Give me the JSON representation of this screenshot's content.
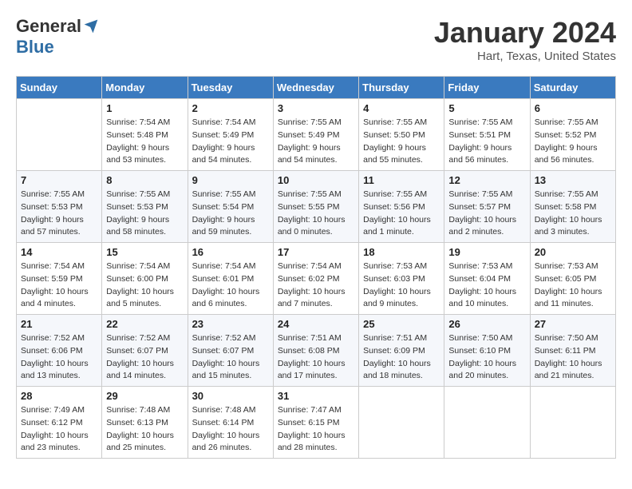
{
  "logo": {
    "general": "General",
    "blue": "Blue"
  },
  "title": {
    "month": "January 2024",
    "location": "Hart, Texas, United States"
  },
  "header_days": [
    "Sunday",
    "Monday",
    "Tuesday",
    "Wednesday",
    "Thursday",
    "Friday",
    "Saturday"
  ],
  "weeks": [
    [
      {
        "day": "",
        "info": ""
      },
      {
        "day": "1",
        "info": "Sunrise: 7:54 AM\nSunset: 5:48 PM\nDaylight: 9 hours\nand 53 minutes."
      },
      {
        "day": "2",
        "info": "Sunrise: 7:54 AM\nSunset: 5:49 PM\nDaylight: 9 hours\nand 54 minutes."
      },
      {
        "day": "3",
        "info": "Sunrise: 7:55 AM\nSunset: 5:49 PM\nDaylight: 9 hours\nand 54 minutes."
      },
      {
        "day": "4",
        "info": "Sunrise: 7:55 AM\nSunset: 5:50 PM\nDaylight: 9 hours\nand 55 minutes."
      },
      {
        "day": "5",
        "info": "Sunrise: 7:55 AM\nSunset: 5:51 PM\nDaylight: 9 hours\nand 56 minutes."
      },
      {
        "day": "6",
        "info": "Sunrise: 7:55 AM\nSunset: 5:52 PM\nDaylight: 9 hours\nand 56 minutes."
      }
    ],
    [
      {
        "day": "7",
        "info": "Sunrise: 7:55 AM\nSunset: 5:53 PM\nDaylight: 9 hours\nand 57 minutes."
      },
      {
        "day": "8",
        "info": "Sunrise: 7:55 AM\nSunset: 5:53 PM\nDaylight: 9 hours\nand 58 minutes."
      },
      {
        "day": "9",
        "info": "Sunrise: 7:55 AM\nSunset: 5:54 PM\nDaylight: 9 hours\nand 59 minutes."
      },
      {
        "day": "10",
        "info": "Sunrise: 7:55 AM\nSunset: 5:55 PM\nDaylight: 10 hours\nand 0 minutes."
      },
      {
        "day": "11",
        "info": "Sunrise: 7:55 AM\nSunset: 5:56 PM\nDaylight: 10 hours\nand 1 minute."
      },
      {
        "day": "12",
        "info": "Sunrise: 7:55 AM\nSunset: 5:57 PM\nDaylight: 10 hours\nand 2 minutes."
      },
      {
        "day": "13",
        "info": "Sunrise: 7:55 AM\nSunset: 5:58 PM\nDaylight: 10 hours\nand 3 minutes."
      }
    ],
    [
      {
        "day": "14",
        "info": "Sunrise: 7:54 AM\nSunset: 5:59 PM\nDaylight: 10 hours\nand 4 minutes."
      },
      {
        "day": "15",
        "info": "Sunrise: 7:54 AM\nSunset: 6:00 PM\nDaylight: 10 hours\nand 5 minutes."
      },
      {
        "day": "16",
        "info": "Sunrise: 7:54 AM\nSunset: 6:01 PM\nDaylight: 10 hours\nand 6 minutes."
      },
      {
        "day": "17",
        "info": "Sunrise: 7:54 AM\nSunset: 6:02 PM\nDaylight: 10 hours\nand 7 minutes."
      },
      {
        "day": "18",
        "info": "Sunrise: 7:53 AM\nSunset: 6:03 PM\nDaylight: 10 hours\nand 9 minutes."
      },
      {
        "day": "19",
        "info": "Sunrise: 7:53 AM\nSunset: 6:04 PM\nDaylight: 10 hours\nand 10 minutes."
      },
      {
        "day": "20",
        "info": "Sunrise: 7:53 AM\nSunset: 6:05 PM\nDaylight: 10 hours\nand 11 minutes."
      }
    ],
    [
      {
        "day": "21",
        "info": "Sunrise: 7:52 AM\nSunset: 6:06 PM\nDaylight: 10 hours\nand 13 minutes."
      },
      {
        "day": "22",
        "info": "Sunrise: 7:52 AM\nSunset: 6:07 PM\nDaylight: 10 hours\nand 14 minutes."
      },
      {
        "day": "23",
        "info": "Sunrise: 7:52 AM\nSunset: 6:07 PM\nDaylight: 10 hours\nand 15 minutes."
      },
      {
        "day": "24",
        "info": "Sunrise: 7:51 AM\nSunset: 6:08 PM\nDaylight: 10 hours\nand 17 minutes."
      },
      {
        "day": "25",
        "info": "Sunrise: 7:51 AM\nSunset: 6:09 PM\nDaylight: 10 hours\nand 18 minutes."
      },
      {
        "day": "26",
        "info": "Sunrise: 7:50 AM\nSunset: 6:10 PM\nDaylight: 10 hours\nand 20 minutes."
      },
      {
        "day": "27",
        "info": "Sunrise: 7:50 AM\nSunset: 6:11 PM\nDaylight: 10 hours\nand 21 minutes."
      }
    ],
    [
      {
        "day": "28",
        "info": "Sunrise: 7:49 AM\nSunset: 6:12 PM\nDaylight: 10 hours\nand 23 minutes."
      },
      {
        "day": "29",
        "info": "Sunrise: 7:48 AM\nSunset: 6:13 PM\nDaylight: 10 hours\nand 25 minutes."
      },
      {
        "day": "30",
        "info": "Sunrise: 7:48 AM\nSunset: 6:14 PM\nDaylight: 10 hours\nand 26 minutes."
      },
      {
        "day": "31",
        "info": "Sunrise: 7:47 AM\nSunset: 6:15 PM\nDaylight: 10 hours\nand 28 minutes."
      },
      {
        "day": "",
        "info": ""
      },
      {
        "day": "",
        "info": ""
      },
      {
        "day": "",
        "info": ""
      }
    ]
  ]
}
